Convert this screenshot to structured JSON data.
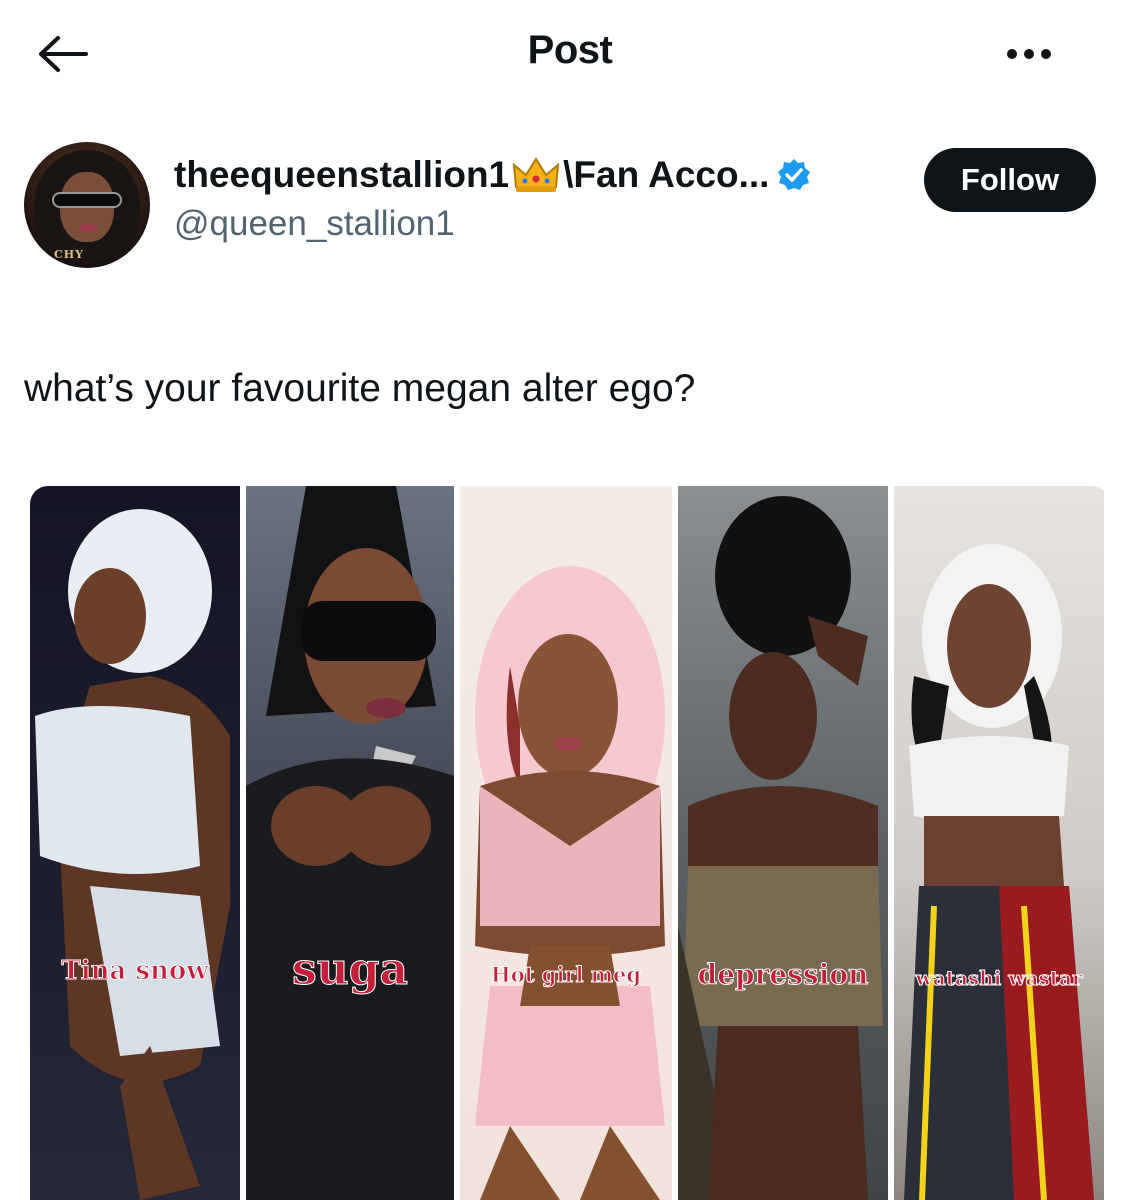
{
  "topbar": {
    "title": "Post",
    "back_icon": "arrow-left-icon",
    "more_icon": "ellipsis-icon"
  },
  "author": {
    "display_name": "theequeenstallion1",
    "name_suffix": "\\Fan Acco...",
    "crown_icon": "crown-emoji",
    "verified_icon": "verified-badge-icon",
    "handle": "@queen_stallion1",
    "avatar_text": "CHY",
    "follow_label": "Follow"
  },
  "post": {
    "text": "what’s your favourite megan alter ego?"
  },
  "media": {
    "panels": [
      {
        "label": "Tina snow"
      },
      {
        "label": "suga"
      },
      {
        "label": "Hot girl meg"
      },
      {
        "label": "depression"
      },
      {
        "label": "watashi wastar"
      }
    ]
  },
  "colors": {
    "text": "#0f1419",
    "secondary": "#536471",
    "verified_blue": "#1d9bf0",
    "follow_bg": "#0f1419",
    "label_red": "#c41e3a"
  }
}
